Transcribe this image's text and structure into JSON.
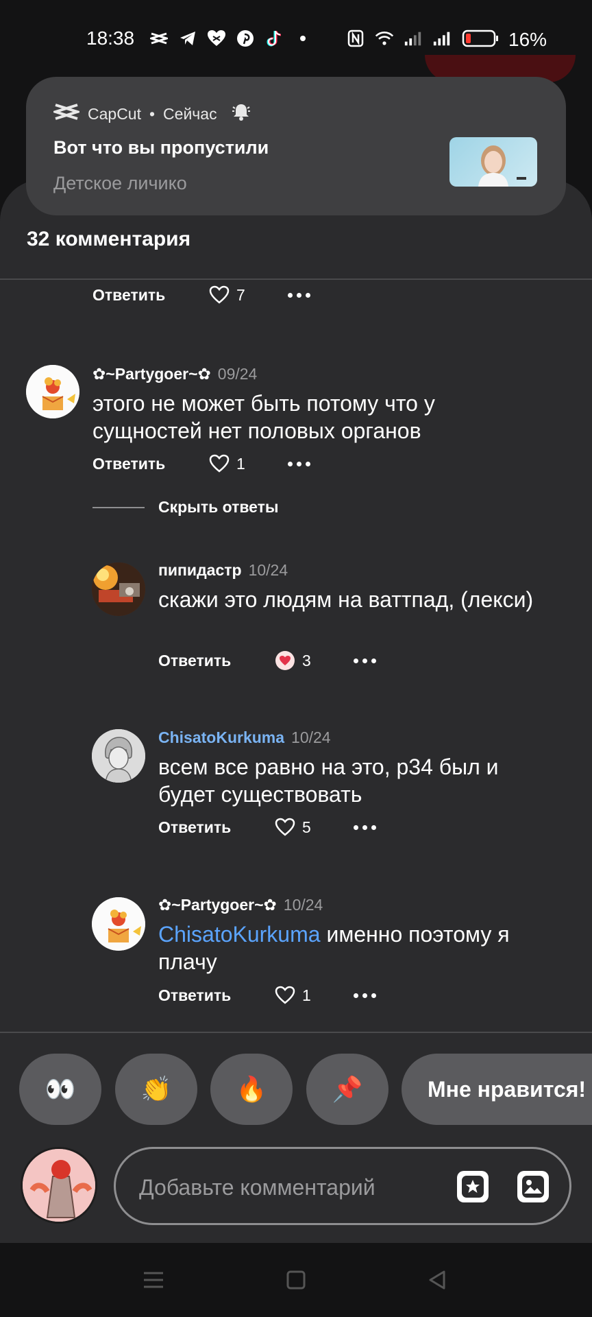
{
  "status_bar": {
    "time": "18:38",
    "battery": "16%",
    "left_icons": [
      "capcut-icon",
      "telegram-icon",
      "heart-icon",
      "pinterest-icon",
      "tiktok-icon",
      "dot-icon"
    ],
    "right_icons": [
      "nfc-icon",
      "wifi-icon",
      "signal-icon",
      "signal-icon",
      "battery-icon"
    ]
  },
  "notification": {
    "app_name": "CapCut",
    "separator": "•",
    "time": "Сейчас",
    "title": "Вот что вы пропустили",
    "body": "Детское личико"
  },
  "sheet": {
    "title": "32 комментария"
  },
  "top_actions": {
    "reply": "Ответить",
    "likes": "7"
  },
  "comments": [
    {
      "author": "✿~Partygoer~✿",
      "date": "09/24",
      "text": "этого не может быть потому что у сущностей нет половых органов",
      "reply": "Ответить",
      "likes": "1"
    }
  ],
  "hide_replies": "Скрыть ответы",
  "replies": [
    {
      "author": "пипидастр",
      "date": "10/24",
      "text": "скажи это людям на ваттпад, (лекси)",
      "reply": "Ответить",
      "likes": "3",
      "reaction": "heart-face"
    },
    {
      "author": "ChisatoKurkuma",
      "date": "10/24",
      "text": "всем все равно на это, р34 был и будет существовать",
      "reply": "Ответить",
      "likes": "5"
    },
    {
      "author": "✿~Partygoer~✿",
      "date": "10/24",
      "mention": "ChisatoKurkuma",
      "text": " именно поэтому я плачу",
      "reply": "Ответить",
      "likes": "1"
    }
  ],
  "reactions": {
    "items": [
      "👀",
      "👏",
      "🔥",
      "📌"
    ],
    "like_label": "Мне нравится!"
  },
  "input": {
    "placeholder": "Добавьте комментарий"
  },
  "colors": {
    "background": "#2b2b2d",
    "mention": "#5ba4ff",
    "author_blue": "#7ab3f2",
    "pill": "#5b5b5e"
  }
}
